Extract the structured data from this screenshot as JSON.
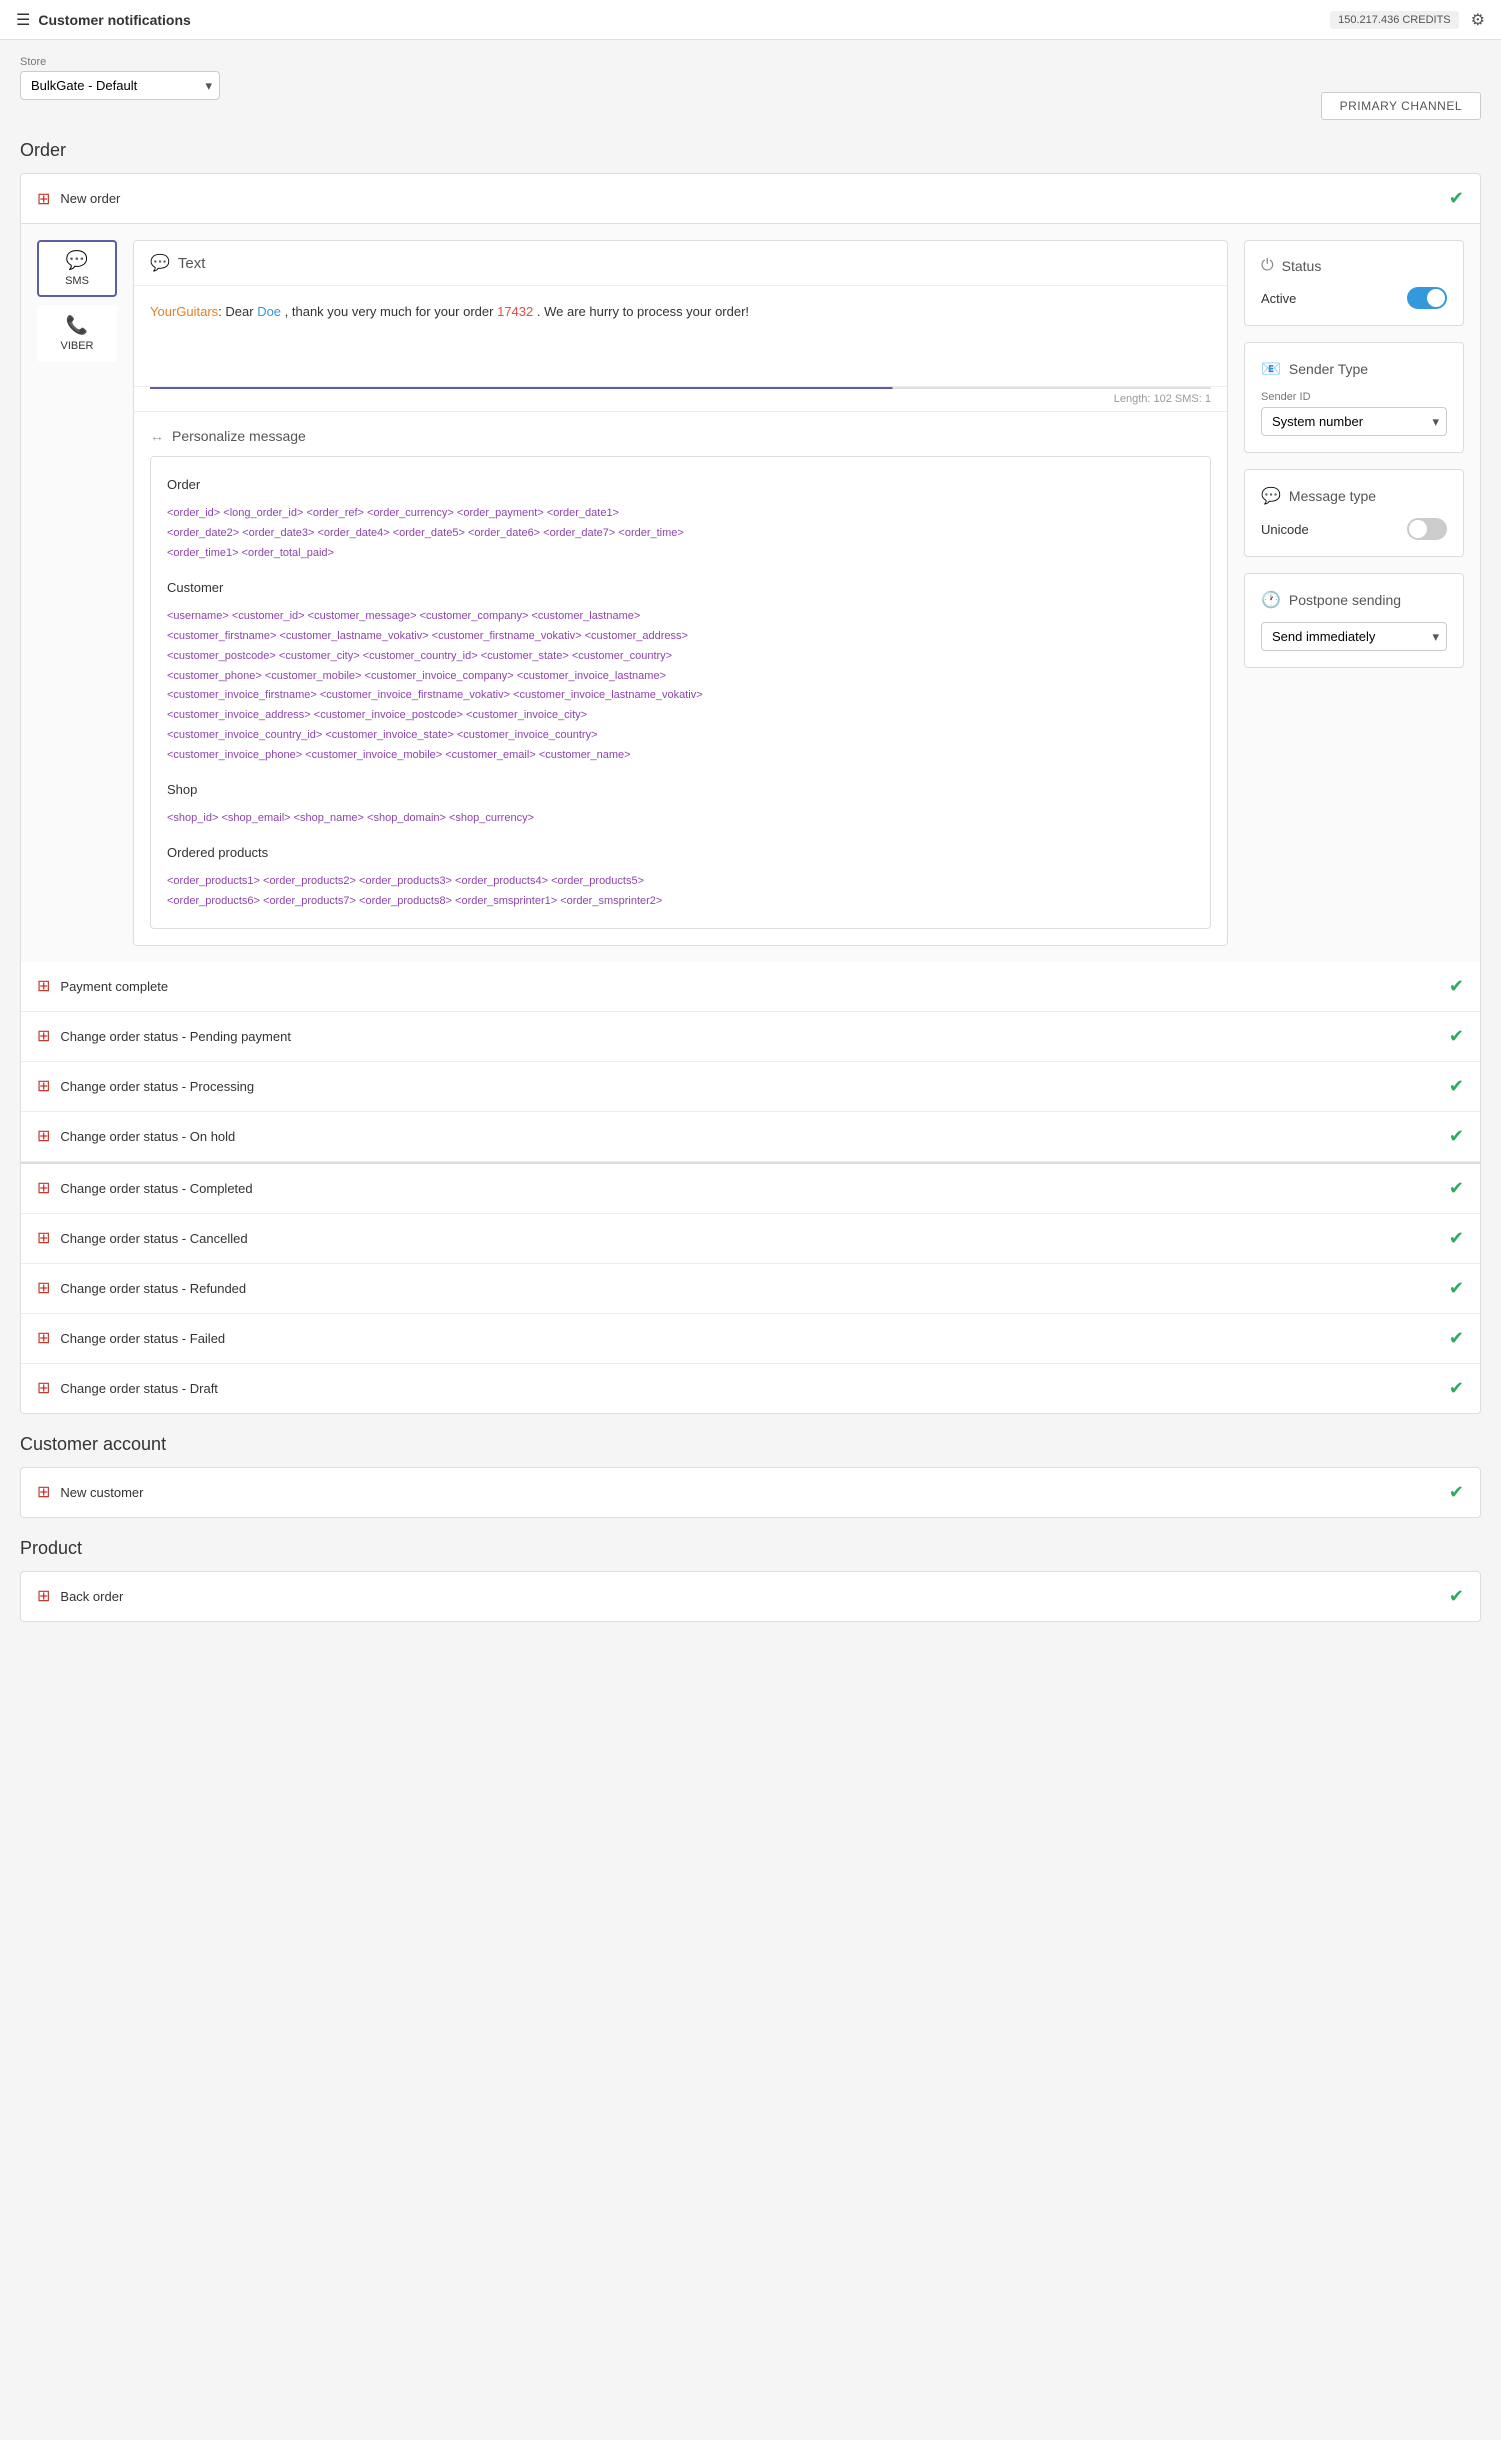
{
  "topbar": {
    "menu_icon": "☰",
    "title": "Customer notifications",
    "credits": "150.217.436 CREDITS",
    "gear_icon": "⚙"
  },
  "store": {
    "label": "Store",
    "value": "BulkGate - Default",
    "options": [
      "BulkGate - Default"
    ]
  },
  "primary_channel_btn": "PRIMARY CHANNEL",
  "sections": [
    {
      "title": "Order",
      "groups": [
        {
          "id": "new-order",
          "label": "New order",
          "expanded": true,
          "active": true,
          "channels": [
            {
              "id": "sms",
              "label": "SMS",
              "icon": "💬",
              "active": true
            },
            {
              "id": "viber",
              "label": "VIBER",
              "icon": "📞",
              "active": false
            }
          ],
          "message": {
            "type": "Text",
            "type_icon": "💬",
            "preview_shop": "YourGuitars",
            "preview_name": "Doe",
            "preview_number": "17432",
            "preview_text": ": Dear  , thank you very much for your order  . We are hurry to process your order!",
            "length": "Length: 102  SMS: 1"
          },
          "personalize": {
            "label": "Personalize message",
            "categories": [
              {
                "name": "Order",
                "tags": "<order_id> <long_order_id> <order_ref> <order_currency> <order_payment> <order_date1> <order_date2> <order_date3> <order_date4> <order_date5> <order_date6> <order_date7> <order_time> <order_time1> <order_total_paid>"
              },
              {
                "name": "Customer",
                "tags": "<username> <customer_id> <customer_message> <customer_company> <customer_lastname> <customer_firstname> <customer_lastname_vokativ> <customer_firstname_vokativ> <customer_address> <customer_postcode> <customer_city> <customer_country_id> <customer_state> <customer_country> <customer_phone> <customer_mobile> <customer_invoice_company> <customer_invoice_lastname> <customer_invoice_firstname> <customer_invoice_firstname_vokativ> <customer_invoice_lastname_vokativ> <customer_invoice_address> <customer_invoice_postcode> <customer_invoice_city> <customer_invoice_country_id> <customer_invoice_state> <customer_invoice_country> <customer_invoice_phone> <customer_invoice_mobile> <customer_email> <customer_name>"
              },
              {
                "name": "Shop",
                "tags": "<shop_id> <shop_email> <shop_name> <shop_domain> <shop_currency>"
              },
              {
                "name": "Ordered products",
                "tags": "<order_products1> <order_products2> <order_products3> <order_products4> <order_products5> <order_products6> <order_products7> <order_products8> <order_smsprinter1> <order_smsprinter2>"
              }
            ]
          },
          "status": {
            "label": "Status",
            "value": "Active",
            "enabled": true
          },
          "sender_type": {
            "label": "Sender Type",
            "field_label": "Sender ID",
            "value": "System number",
            "options": [
              "System number"
            ]
          },
          "message_type": {
            "label": "Message type",
            "value": "Unicode",
            "enabled": false
          },
          "postpone": {
            "label": "Postpone sending",
            "value": "Send immediately",
            "options": [
              "Send immediately"
            ]
          }
        },
        {
          "id": "payment-complete",
          "label": "Payment complete",
          "expanded": false,
          "active": true
        },
        {
          "id": "change-pending",
          "label": "Change order status - Pending payment",
          "expanded": false,
          "active": true
        },
        {
          "id": "change-processing",
          "label": "Change order status - Processing",
          "expanded": false,
          "active": true
        },
        {
          "id": "change-onhold",
          "label": "Change order status - On hold",
          "expanded": false,
          "active": true
        },
        {
          "id": "change-completed",
          "label": "Change order status - Completed",
          "expanded": false,
          "active": true
        },
        {
          "id": "change-cancelled",
          "label": "Change order status - Cancelled",
          "expanded": false,
          "active": true
        },
        {
          "id": "change-refunded",
          "label": "Change order status - Refunded",
          "expanded": false,
          "active": true
        },
        {
          "id": "change-failed",
          "label": "Change order status - Failed",
          "expanded": false,
          "active": true
        },
        {
          "id": "change-draft",
          "label": "Change order status - Draft",
          "expanded": false,
          "active": true
        }
      ]
    },
    {
      "title": "Customer account",
      "groups": [
        {
          "id": "new-customer",
          "label": "New customer",
          "expanded": false,
          "active": true
        }
      ]
    },
    {
      "title": "Product",
      "groups": [
        {
          "id": "back-order",
          "label": "Back order",
          "expanded": false,
          "active": true
        }
      ]
    }
  ]
}
